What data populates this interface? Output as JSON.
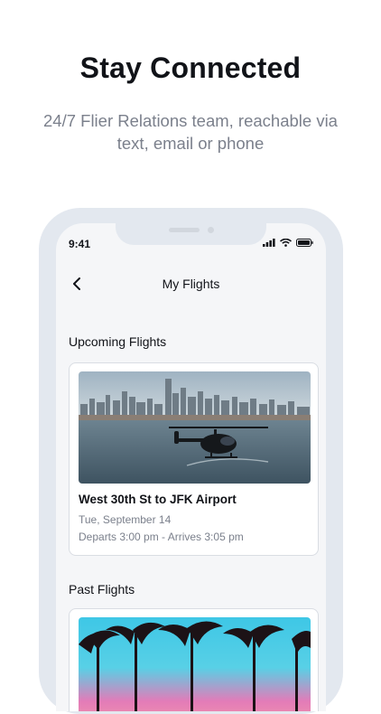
{
  "promo": {
    "headline": "Stay Connected",
    "subline": "24/7 Flier Relations team, reachable via text, email or phone"
  },
  "status_bar": {
    "time": "9:41",
    "icons": [
      "signal-icon",
      "wifi-icon",
      "battery-icon"
    ]
  },
  "nav": {
    "back_icon": "chevron-left-icon",
    "title": "My Flights"
  },
  "upcoming": {
    "title": "Upcoming Flights",
    "flights": [
      {
        "image": "helicopter-over-manhattan-skyline",
        "route": "West 30th St to JFK Airport",
        "date": "Tue, September 14",
        "times": "Departs 3:00 pm - Arrives 3:05 pm"
      }
    ]
  },
  "past": {
    "title": "Past Flights",
    "flights": [
      {
        "image": "palm-trees-sunset"
      }
    ]
  },
  "colors": {
    "frame": "#e3e8ef",
    "screen_bg": "#f5f6f8",
    "text_primary": "#111318",
    "text_secondary": "#7b808c",
    "card_border": "#d9dde3"
  }
}
